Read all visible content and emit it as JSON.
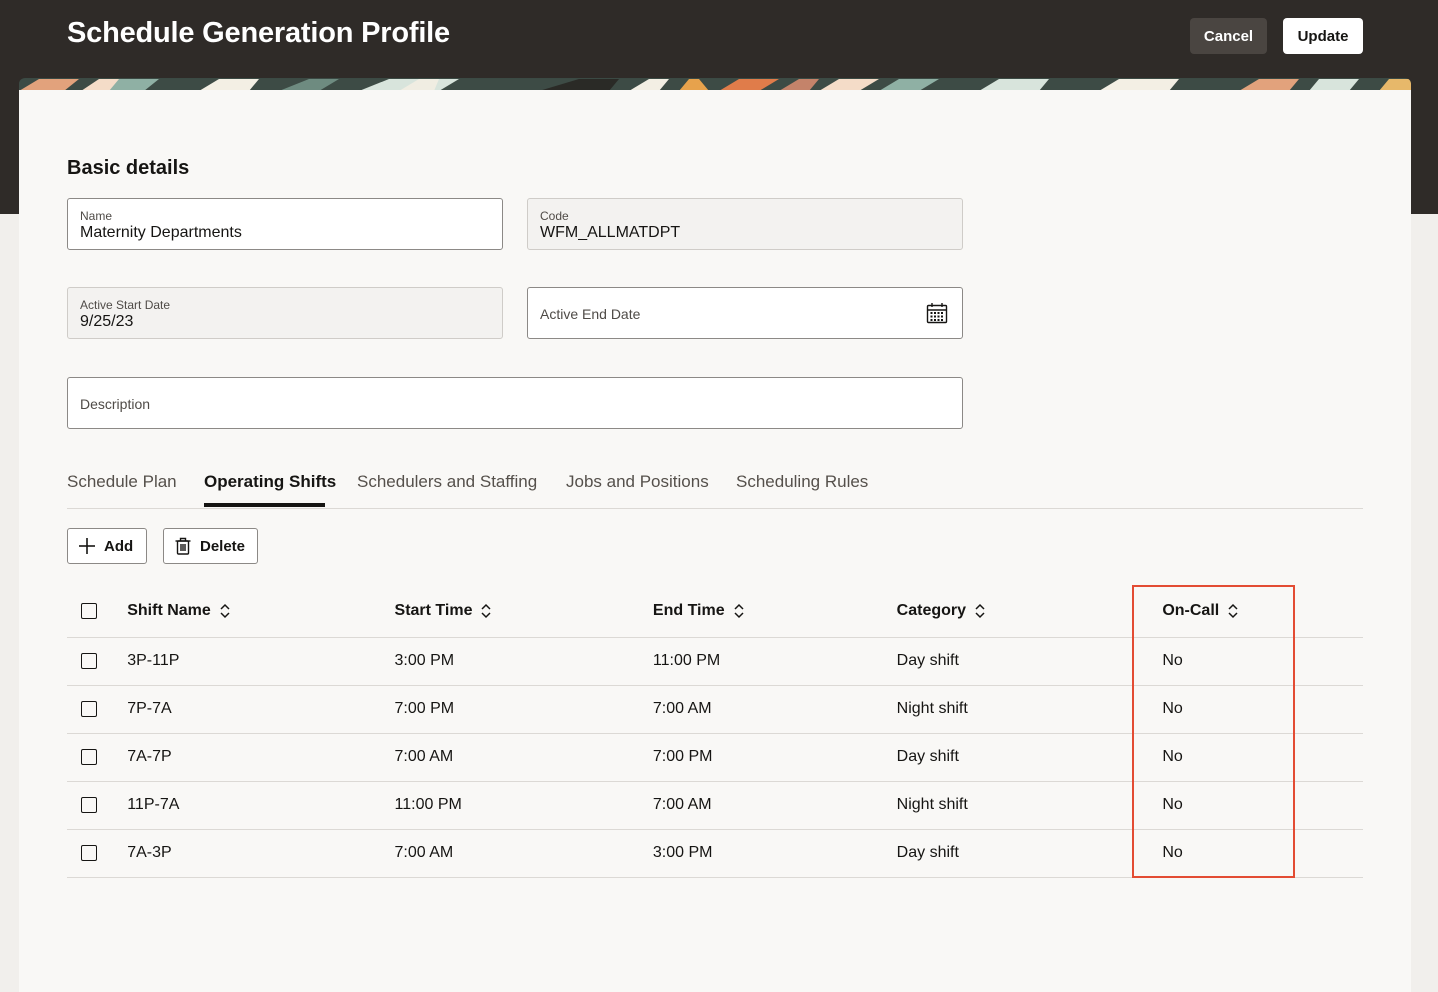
{
  "header": {
    "title": "Schedule Generation Profile",
    "cancel_label": "Cancel",
    "update_label": "Update"
  },
  "section": {
    "title": "Basic details"
  },
  "fields": {
    "name": {
      "label": "Name",
      "value": "Maternity Departments"
    },
    "code": {
      "label": "Code",
      "value": "WFM_ALLMATDPT"
    },
    "active_start": {
      "label": "Active Start Date",
      "value": "9/25/23"
    },
    "active_end": {
      "placeholder": "Active End Date",
      "icon": "calendar-icon"
    },
    "description": {
      "placeholder": "Description"
    }
  },
  "tabs": [
    {
      "label": "Schedule Plan",
      "active": false
    },
    {
      "label": "Operating Shifts",
      "active": true
    },
    {
      "label": "Schedulers and Staffing",
      "active": false
    },
    {
      "label": "Jobs and Positions",
      "active": false
    },
    {
      "label": "Scheduling Rules",
      "active": false
    }
  ],
  "toolbar": {
    "add_label": "Add",
    "delete_label": "Delete"
  },
  "table": {
    "columns": [
      "Shift Name",
      "Start Time",
      "End Time",
      "Category",
      "On-Call"
    ],
    "rows": [
      [
        "3P-11P",
        "3:00 PM",
        "11:00 PM",
        "Day shift",
        "No"
      ],
      [
        "7P-7A",
        "7:00 PM",
        "7:00 AM",
        "Night shift",
        "No"
      ],
      [
        "7A-7P",
        "7:00 AM",
        "7:00 PM",
        "Day shift",
        "No"
      ],
      [
        "11P-7A",
        "11:00 PM",
        "7:00 AM",
        "Night shift",
        "No"
      ],
      [
        "7A-3P",
        "7:00 AM",
        "3:00 PM",
        "Day shift",
        "No"
      ]
    ]
  },
  "colors": {
    "header_bg": "#2f2b28",
    "highlight": "#e34c33",
    "panel_bg": "#f9f8f6"
  }
}
